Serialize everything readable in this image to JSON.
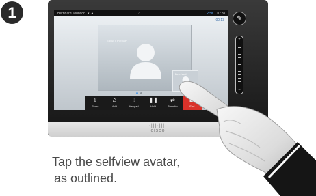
{
  "step": {
    "number": "1"
  },
  "status_bar": {
    "user": "Bernhard Johnson",
    "center_icon": "home-icon",
    "network": "2.5K",
    "time": "10:28"
  },
  "call": {
    "timer": "00:13",
    "remote_name": "Jane Oneson",
    "selfview_name": "Bernhard"
  },
  "controls": [
    {
      "label": "Share",
      "icon": "share-icon"
    },
    {
      "label": "Add",
      "icon": "add-participant-icon"
    },
    {
      "label": "Keypad",
      "icon": "keypad-icon"
    },
    {
      "label": "Hold",
      "icon": "pause-icon"
    },
    {
      "label": "Transfer",
      "icon": "transfer-icon"
    },
    {
      "label": "End",
      "icon": "end-call-icon"
    }
  ],
  "device": {
    "brand": "cisco"
  },
  "caption": {
    "line1": "Tap the selfview avatar,",
    "line2": "as outlined."
  },
  "colors": {
    "end_call": "#d9322a",
    "accent_blue": "#5b9de0",
    "bezel": "#1e1e1e"
  }
}
